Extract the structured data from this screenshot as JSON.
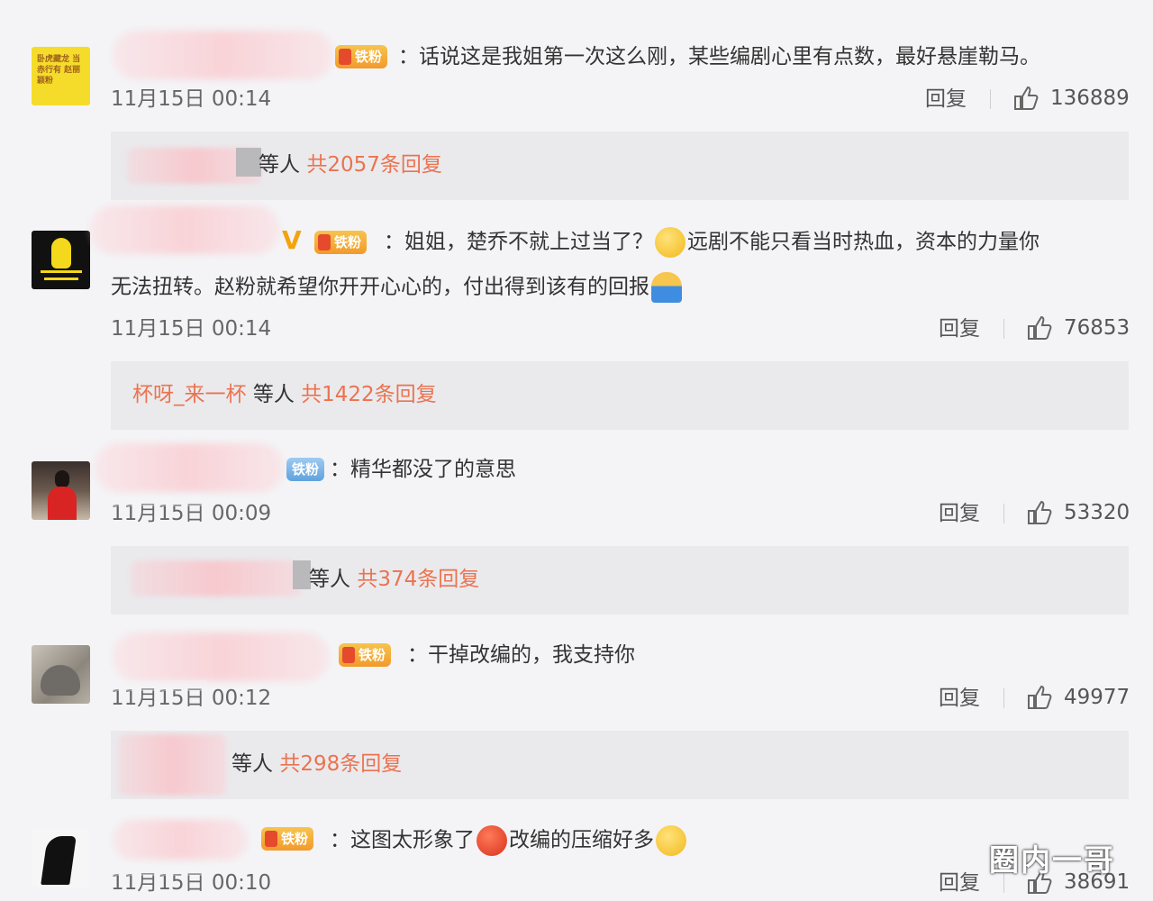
{
  "comments": [
    {
      "badge": "铁粉",
      "text": "：话说这是我姐第一次这么刚，某些编剧心里有点数，最好悬崖勒马。",
      "time": "11月15日 00:14",
      "reply_label": "回复",
      "likes": "136889",
      "sub": {
        "user": "",
        "deng": "等人",
        "count": "共2057条回复"
      },
      "avatar_text": "卧虎藏龙 当赤行有 赵丽颖粉"
    },
    {
      "badge": "铁粉",
      "verified_mark": "V",
      "text_line1_a": "：姐姐，楚乔不就上过当了？",
      "text_line1_b": "远剧不能只看当时热血，资本的力量你",
      "text_line2": "无法扭转。赵粉就希望你开开心心的，付出得到该有的回报",
      "time": "11月15日 00:14",
      "reply_label": "回复",
      "likes": "76853",
      "sub": {
        "user": "杯呀_来一杯",
        "deng": "等人",
        "count": "共1422条回复"
      }
    },
    {
      "badge": "铁粉",
      "text": "：精华都没了的意思",
      "time": "11月15日 00:09",
      "reply_label": "回复",
      "likes": "53320",
      "sub": {
        "user": "",
        "deng": "等人",
        "count": "共374条回复"
      }
    },
    {
      "badge": "铁粉",
      "text": "：干掉改编的，我支持你",
      "time": "11月15日 00:12",
      "reply_label": "回复",
      "likes": "49977",
      "sub": {
        "user": "",
        "deng": "等人",
        "count": "共298条回复"
      }
    },
    {
      "badge": "铁粉",
      "text_a": "：这图太形象了",
      "text_b": "改编的压缩好多",
      "time": "11月15日 00:10",
      "reply_label": "回复",
      "likes": "38691"
    }
  ],
  "watermark": "圈内一哥",
  "colors": {
    "accent": "#eb7350",
    "badge_orange": "#f29a2a",
    "badge_blue": "#5fa2dd",
    "background": "#f4f4f6"
  },
  "icons": {
    "like": "thumbs-up-icon",
    "emoji": "emoji-icon"
  }
}
